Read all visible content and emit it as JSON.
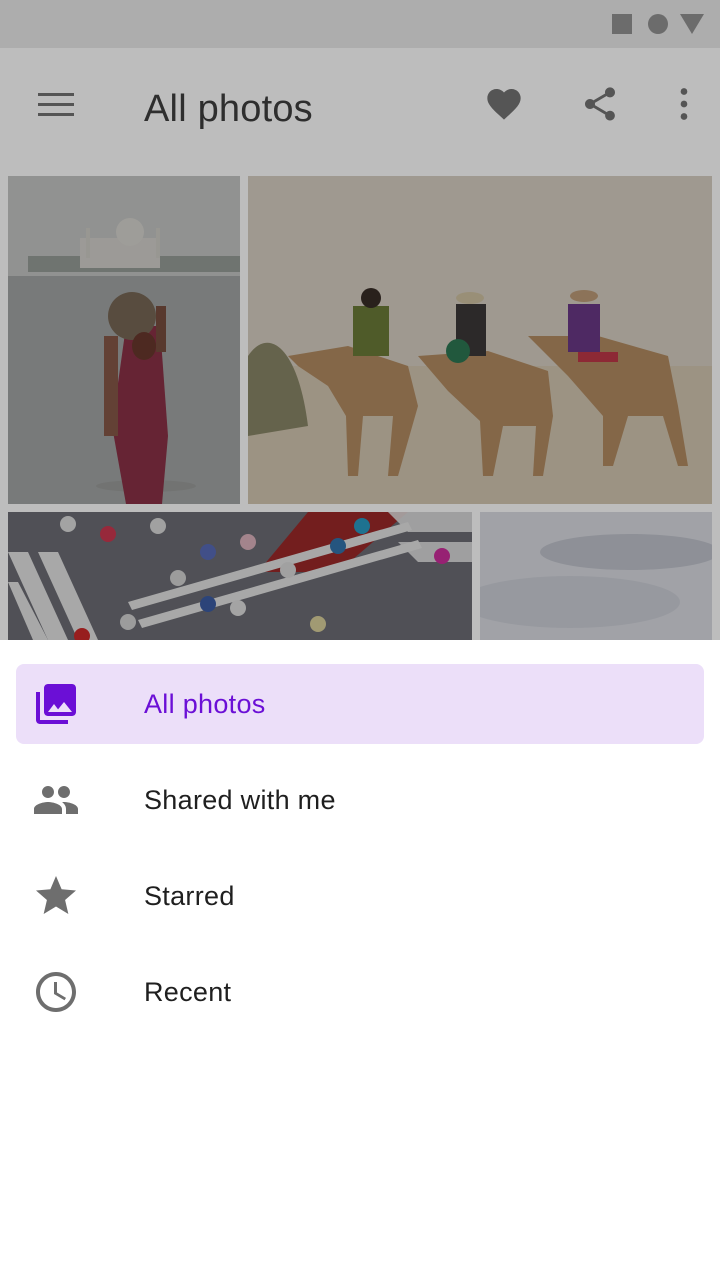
{
  "status_bar": {
    "icons": [
      "square-icon",
      "circle-icon",
      "triangle-icon"
    ]
  },
  "app_bar": {
    "title": "All photos",
    "icons": [
      "menu-icon",
      "heart-icon",
      "share-icon",
      "more-vert-icon"
    ]
  },
  "photos": [
    {
      "subject": "woman carrying a pot by a river with the Taj Mahal behind"
    },
    {
      "subject": "three riders on camels in the desert"
    },
    {
      "subject": "crowd with umbrellas crossing a street"
    },
    {
      "subject": "cloudy sky"
    }
  ],
  "drawer": {
    "items": [
      {
        "label": "All photos",
        "icon": "photo-library-icon",
        "active": true
      },
      {
        "label": "Shared with me",
        "icon": "people-icon",
        "active": false
      },
      {
        "label": "Starred",
        "icon": "star-icon",
        "active": false
      },
      {
        "label": "Recent",
        "icon": "clock-icon",
        "active": false
      }
    ]
  },
  "colors": {
    "accent": "#6b0fd6",
    "active_background": "#ecdff9",
    "icon_grey": "#6e6e6e",
    "scrim_app_bar": "#bdbdbd"
  }
}
